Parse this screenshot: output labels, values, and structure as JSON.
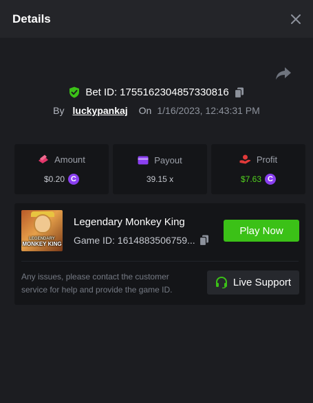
{
  "header": {
    "title": "Details"
  },
  "bet": {
    "label": "Bet ID:",
    "id": "1755162304857330816",
    "by_label": "By",
    "user": "luckypankaj",
    "on_label": "On",
    "date": "1/16/2023, 12:43:31 PM"
  },
  "stats": {
    "amount": {
      "label": "Amount",
      "value": "$0.20"
    },
    "payout": {
      "label": "Payout",
      "value": "39.15 x"
    },
    "profit": {
      "label": "Profit",
      "value": "$7.63"
    }
  },
  "currency_symbol": "C",
  "game": {
    "name": "Legendary Monkey King",
    "id_text": "Game ID: 1614883506759...",
    "thumb_line1": "LEGENDARY",
    "thumb_line2": "MONKEY KING",
    "play_label": "Play Now"
  },
  "support": {
    "text": "Any issues, please contact the customer service for help and provide the game ID.",
    "button_label": "Live Support"
  },
  "colors": {
    "accent_green": "#3bc117",
    "profit_green": "#52d11e",
    "coin_purple": "#8a3ff0",
    "amount_icon": "#e2366a",
    "payout_icon": "#8a3ff0",
    "profit_icon": "#e23a3a"
  },
  "icons": {
    "close": "close-icon",
    "share": "share-icon",
    "shield": "shield-check-icon",
    "copy": "copy-icon",
    "amount": "chips-icon",
    "payout": "wallet-icon",
    "profit": "hand-coin-icon",
    "headset": "headset-icon"
  }
}
